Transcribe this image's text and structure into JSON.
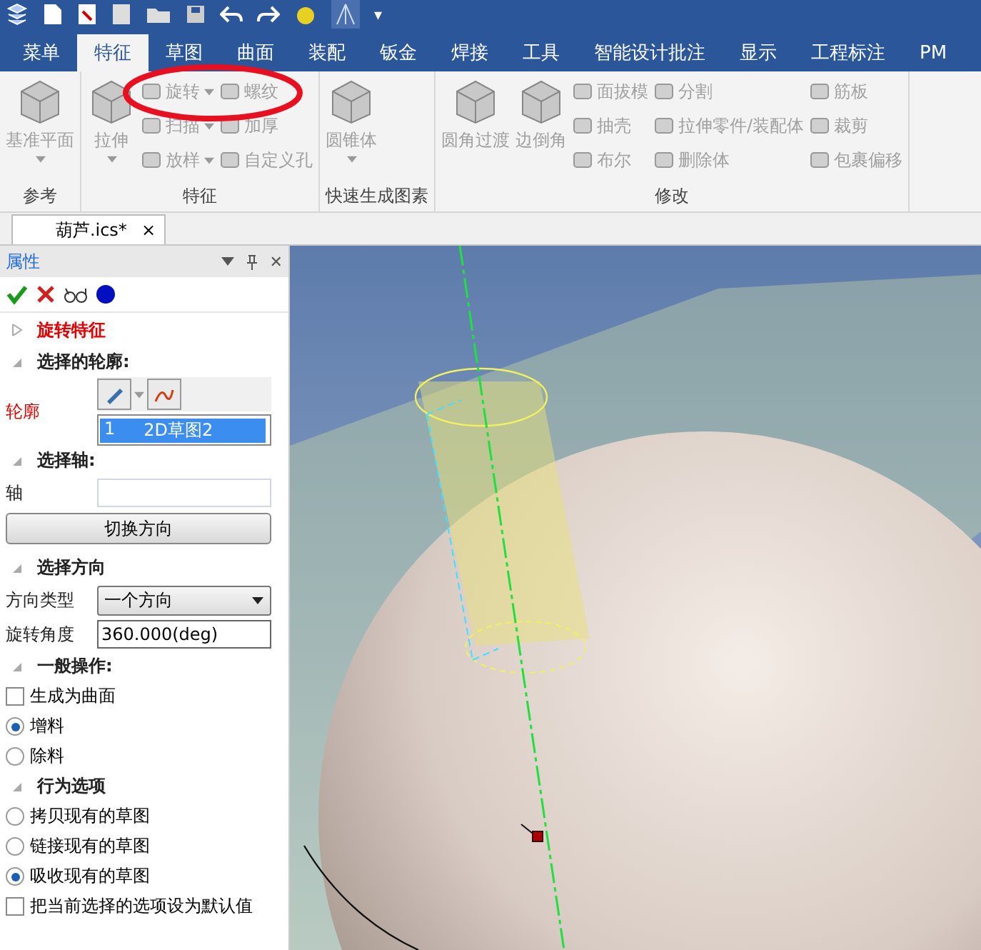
{
  "quick_access": {
    "menu_glyph": "▾"
  },
  "ribbon_tabs": [
    {
      "label": "菜单",
      "selected": false
    },
    {
      "label": "特征",
      "selected": true
    },
    {
      "label": "草图",
      "selected": false
    },
    {
      "label": "曲面",
      "selected": false
    },
    {
      "label": "装配",
      "selected": false
    },
    {
      "label": "钣金",
      "selected": false
    },
    {
      "label": "焊接",
      "selected": false
    },
    {
      "label": "工具",
      "selected": false
    },
    {
      "label": "智能设计批注",
      "selected": false
    },
    {
      "label": "显示",
      "selected": false
    },
    {
      "label": "工程标注",
      "selected": false
    },
    {
      "label": "PM",
      "selected": false
    }
  ],
  "ribbon_groups": [
    {
      "title": "参考",
      "columns": [
        [
          {
            "kind": "large",
            "label": "基准平面",
            "dropdown": true,
            "disabled": true
          }
        ]
      ]
    },
    {
      "title": "特征",
      "columns": [
        [
          {
            "kind": "large",
            "label": "拉伸",
            "dropdown": true,
            "disabled": true
          }
        ],
        [
          {
            "kind": "small",
            "label": "旋转",
            "dropdown": true,
            "disabled": true
          },
          {
            "kind": "small",
            "label": "扫描",
            "dropdown": true,
            "disabled": true
          },
          {
            "kind": "small",
            "label": "放样",
            "dropdown": true,
            "disabled": true
          }
        ],
        [
          {
            "kind": "small",
            "label": "螺纹",
            "dropdown": false,
            "disabled": true
          },
          {
            "kind": "small",
            "label": "加厚",
            "dropdown": false,
            "disabled": true
          },
          {
            "kind": "small",
            "label": "自定义孔",
            "dropdown": false,
            "disabled": true
          }
        ]
      ]
    },
    {
      "title": "快速生成图素",
      "columns": [
        [
          {
            "kind": "large",
            "label": "圆锥体",
            "dropdown": true,
            "disabled": true
          }
        ]
      ]
    },
    {
      "title": "修改",
      "columns": [
        [
          {
            "kind": "large",
            "label": "圆角过渡",
            "dropdown": false,
            "disabled": true
          }
        ],
        [
          {
            "kind": "large",
            "label": "边倒角",
            "dropdown": false,
            "disabled": true
          }
        ],
        [
          {
            "kind": "small",
            "label": "面拔模",
            "dropdown": false,
            "disabled": true
          },
          {
            "kind": "small",
            "label": "抽壳",
            "dropdown": false,
            "disabled": true
          },
          {
            "kind": "small",
            "label": "布尔",
            "dropdown": false,
            "disabled": true
          }
        ],
        [
          {
            "kind": "small",
            "label": "分割",
            "dropdown": false,
            "disabled": true
          },
          {
            "kind": "small",
            "label": "拉伸零件/装配体",
            "dropdown": false,
            "disabled": true
          },
          {
            "kind": "small",
            "label": "删除体",
            "dropdown": false,
            "disabled": true
          }
        ],
        [
          {
            "kind": "small",
            "label": "筋板",
            "dropdown": false,
            "disabled": true
          },
          {
            "kind": "small",
            "label": "裁剪",
            "dropdown": false,
            "disabled": true
          },
          {
            "kind": "small",
            "label": "包裹偏移",
            "dropdown": false,
            "disabled": true
          }
        ]
      ]
    }
  ],
  "document_tab": {
    "title": "葫芦.ics*",
    "close": "×"
  },
  "panel": {
    "title": "属性",
    "close": "✕",
    "rows": [
      {
        "kind": "title",
        "label": "旋转特征",
        "expanded": false
      },
      {
        "kind": "section",
        "label": "选择的轮廓:",
        "expanded": true
      },
      {
        "kind": "profile",
        "label": "轮廓",
        "items": [
          {
            "index": "1",
            "name": "2D草图2",
            "selected": true
          }
        ]
      },
      {
        "kind": "section",
        "label": "选择轴:",
        "expanded": true
      },
      {
        "kind": "field",
        "label": "轴",
        "value": ""
      },
      {
        "kind": "button",
        "label": "切换方向"
      },
      {
        "kind": "section",
        "label": "选择方向",
        "expanded": true
      },
      {
        "kind": "select",
        "label": "方向类型",
        "value": "一个方向"
      },
      {
        "kind": "field",
        "label": "旋转角度",
        "value": "360.000(deg)"
      },
      {
        "kind": "section",
        "label": "一般操作:",
        "expanded": true
      },
      {
        "kind": "checkbox",
        "label": "生成为曲面",
        "checked": false
      },
      {
        "kind": "radio",
        "label": "增料",
        "selected": true
      },
      {
        "kind": "radio",
        "label": "除料",
        "selected": false
      },
      {
        "kind": "section",
        "label": "行为选项",
        "expanded": true
      },
      {
        "kind": "radio",
        "label": "拷贝现有的草图",
        "selected": false
      },
      {
        "kind": "radio",
        "label": "链接现有的草图",
        "selected": false
      },
      {
        "kind": "radio",
        "label": "吸收现有的草图",
        "selected": true
      },
      {
        "kind": "checkbox",
        "label": "把当前选择的选项设为默认值",
        "checked": false
      }
    ]
  }
}
